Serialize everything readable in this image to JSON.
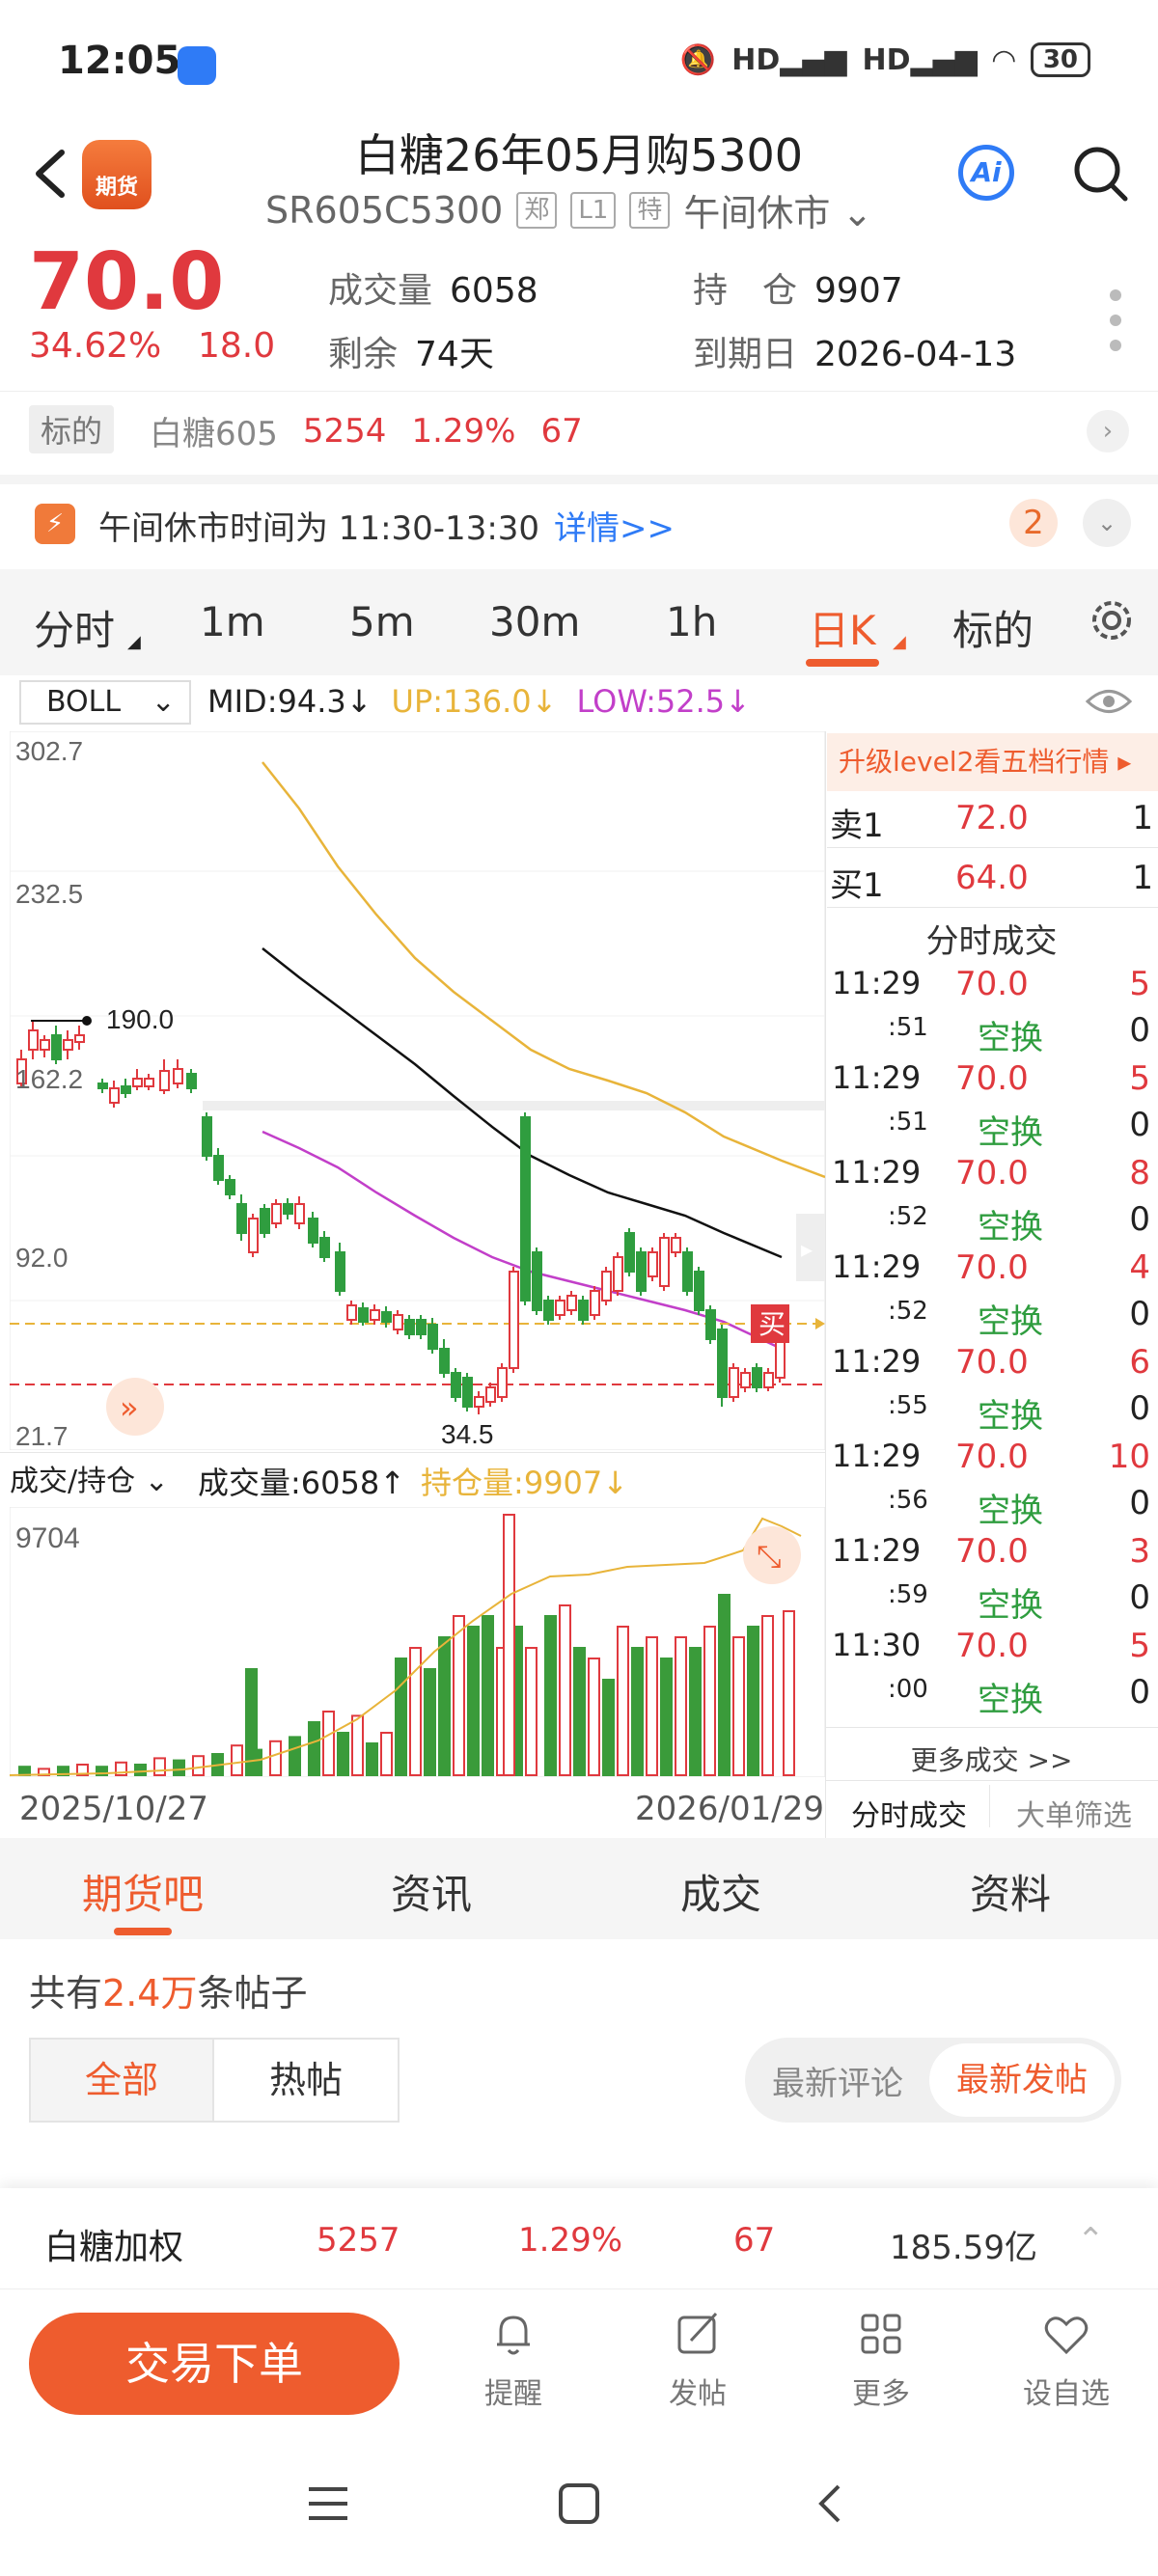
{
  "status_bar": {
    "time": "12:05",
    "signal_1": "HD",
    "signal_2": "HD",
    "battery": "30"
  },
  "header": {
    "title": "白糖26年05月购5300",
    "code": "SR605C5300",
    "tag_exchange": "郑",
    "tag_level": "L1",
    "tag_special": "特",
    "market_status": "午间休市",
    "app_logo_text": "期货",
    "ai_label": "Ai"
  },
  "quote": {
    "price": "70.0",
    "pct": "34.62%",
    "change": "18.0",
    "volume_label": "成交量",
    "volume": "6058",
    "oi_label": "持　仓",
    "oi": "9907",
    "remaining_label": "剩余",
    "remaining": "74天",
    "expiry_label": "到期日",
    "expiry": "2026-04-13"
  },
  "underlying": {
    "label": "标的",
    "name": "白糖605",
    "price": "5254",
    "pct": "1.29%",
    "change": "67"
  },
  "notice": {
    "text": "午间休市时间为 11:30-13:30",
    "link": "详情>>",
    "badge": "2"
  },
  "period_tabs": [
    {
      "label": "分时"
    },
    {
      "label": "1m"
    },
    {
      "label": "5m"
    },
    {
      "label": "30m"
    },
    {
      "label": "1h"
    },
    {
      "label": "日K"
    },
    {
      "label": "标的"
    }
  ],
  "indicator": {
    "name": "BOLL",
    "mid": "MID:94.3↓",
    "up": "UP:136.0↓",
    "low": "LOW:52.5↓",
    "up_color": "#e8b43a",
    "low_color": "#c23fc9"
  },
  "chart_labels": {
    "y_302": "302.7",
    "y_232": "232.5",
    "y_162": "162.2",
    "y_92": "92.0",
    "y_21": "21.7",
    "high_mark": "190.0",
    "low_mark": "34.5",
    "buy_tag": "买"
  },
  "chart_data": {
    "type": "candlestick",
    "y_range": [
      21.7,
      302.7
    ],
    "y_ticks": [
      302.7,
      232.5,
      162.2,
      92.0,
      21.7
    ],
    "max_label": 190.0,
    "min_label": 34.5,
    "last_price": 70.0,
    "ref_line": 62.0,
    "volume_max_label": 9704,
    "x_range": [
      "2025/10/27",
      "2026/01/29"
    ]
  },
  "volume_section": {
    "selector": "成交/持仓",
    "volume": "成交量:6058↑",
    "oi": "持仓量:9907↓",
    "max_label": "9704"
  },
  "dates": {
    "start": "2025/10/27",
    "end": "2026/01/29"
  },
  "order_book": {
    "banner": "升级level2看五档行情 ▸",
    "ask": {
      "label": "卖1",
      "price": "72.0",
      "qty": "1"
    },
    "bid": {
      "label": "买1",
      "price": "64.0",
      "qty": "1"
    },
    "ticks_title": "分时成交",
    "ticks": [
      {
        "time": "11:29",
        "sec": ":51",
        "price": "70.0",
        "type": "空换",
        "vol": "5",
        "vol2": "0"
      },
      {
        "time": "11:29",
        "sec": ":51",
        "price": "70.0",
        "type": "空换",
        "vol": "5",
        "vol2": "0"
      },
      {
        "time": "11:29",
        "sec": ":52",
        "price": "70.0",
        "type": "空换",
        "vol": "8",
        "vol2": "0"
      },
      {
        "time": "11:29",
        "sec": ":52",
        "price": "70.0",
        "type": "空换",
        "vol": "4",
        "vol2": "0"
      },
      {
        "time": "11:29",
        "sec": ":55",
        "price": "70.0",
        "type": "空换",
        "vol": "6",
        "vol2": "0"
      },
      {
        "time": "11:29",
        "sec": ":56",
        "price": "70.0",
        "type": "空换",
        "vol": "10",
        "vol2": "0"
      },
      {
        "time": "11:29",
        "sec": ":59",
        "price": "70.0",
        "type": "空换",
        "vol": "3",
        "vol2": "0"
      },
      {
        "time": "11:30",
        "sec": ":00",
        "price": "70.0",
        "type": "空换",
        "vol": "5",
        "vol2": "0"
      }
    ],
    "more": "更多成交 >>",
    "footer_tab_1": "分时成交",
    "footer_tab_2": "大单筛选"
  },
  "content_tabs": [
    {
      "label": "期货吧"
    },
    {
      "label": "资讯"
    },
    {
      "label": "成交"
    },
    {
      "label": "资料"
    }
  ],
  "posts": {
    "count_prefix": "共有",
    "count": "2.4万",
    "count_suffix": "条帖子",
    "filter_all": "全部",
    "filter_hot": "热帖",
    "sort_comment": "最新评论",
    "sort_post": "最新发帖"
  },
  "ticker": {
    "name": "白糖加权",
    "price": "5257",
    "pct": "1.29%",
    "change": "67",
    "amount": "185.59亿"
  },
  "actions": {
    "trade": "交易下单",
    "remind": "提醒",
    "post": "发帖",
    "more": "更多",
    "watch": "设自选"
  }
}
